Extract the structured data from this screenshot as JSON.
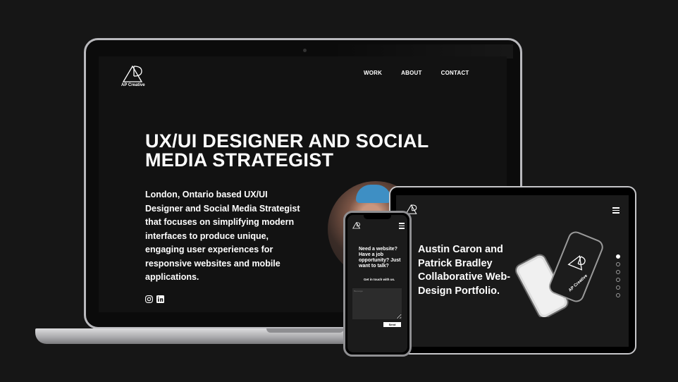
{
  "laptop": {
    "brand": "AP Creative",
    "nav": [
      "WORK",
      "ABOUT",
      "CONTACT"
    ],
    "hero_title": "UX/UI DESIGNER AND SOCIAL MEDIA STRATEGIST",
    "hero_description": "London, Ontario based UX/UI Designer and Social Media Strategist that focuses on simplifying modern interfaces to produce unique, engaging user experiences for responsive websites and mobile applications.",
    "social_icons": [
      "instagram-icon",
      "linkedin-icon"
    ]
  },
  "tablet": {
    "title": "Austin Caron and Patrick Bradley Collaborative Web-Design Portfolio.",
    "mockup_brand": "AP Creative",
    "slide_count": 6,
    "active_slide": 1
  },
  "phone": {
    "question": "Need a website? Have a job opportunity? Just want to talk?",
    "contact_label": "Get in touch with us.",
    "textarea_placeholder": "Message",
    "send_label": "Send"
  },
  "colors": {
    "background": "#161616",
    "screen": "#121212",
    "accent": "#ffffff",
    "device_frame": "#b9b9bd"
  }
}
